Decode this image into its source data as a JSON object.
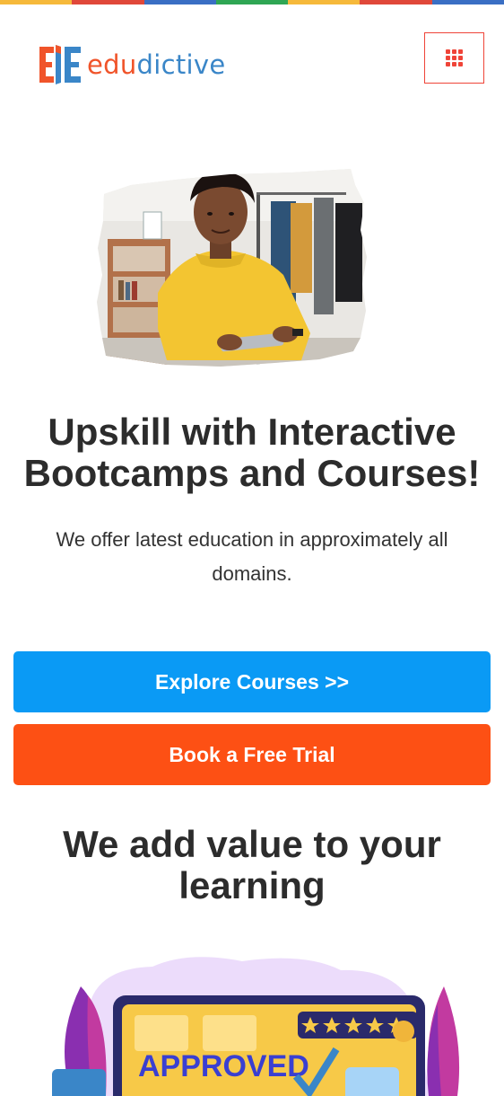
{
  "brand": {
    "name_part1": "edu",
    "name_part2": "dictive",
    "colors": {
      "orange": "#f0542a",
      "blue": "#3a86c8"
    }
  },
  "top_strip_colors": [
    "#f6b93b",
    "#e0483a",
    "#3a6fc4",
    "#2fa654",
    "#f6b93b",
    "#e0483a",
    "#3a6fc4"
  ],
  "header": {
    "menu_icon": "grid-menu-icon",
    "menu_color": "#ef4438"
  },
  "hero": {
    "image_icon": "student-with-tablet-image",
    "title": "Upskill with Interactive Bootcamps and Courses!",
    "subtitle": "We offer latest education in approximately all domains."
  },
  "buttons": {
    "explore_label": "Explore Courses >>",
    "explore_color": "#0a9af5",
    "trial_label": "Book a Free Trial",
    "trial_color": "#fd5014"
  },
  "value_section": {
    "title": "We add value to your learning",
    "illustration_text": "APPROVED"
  }
}
